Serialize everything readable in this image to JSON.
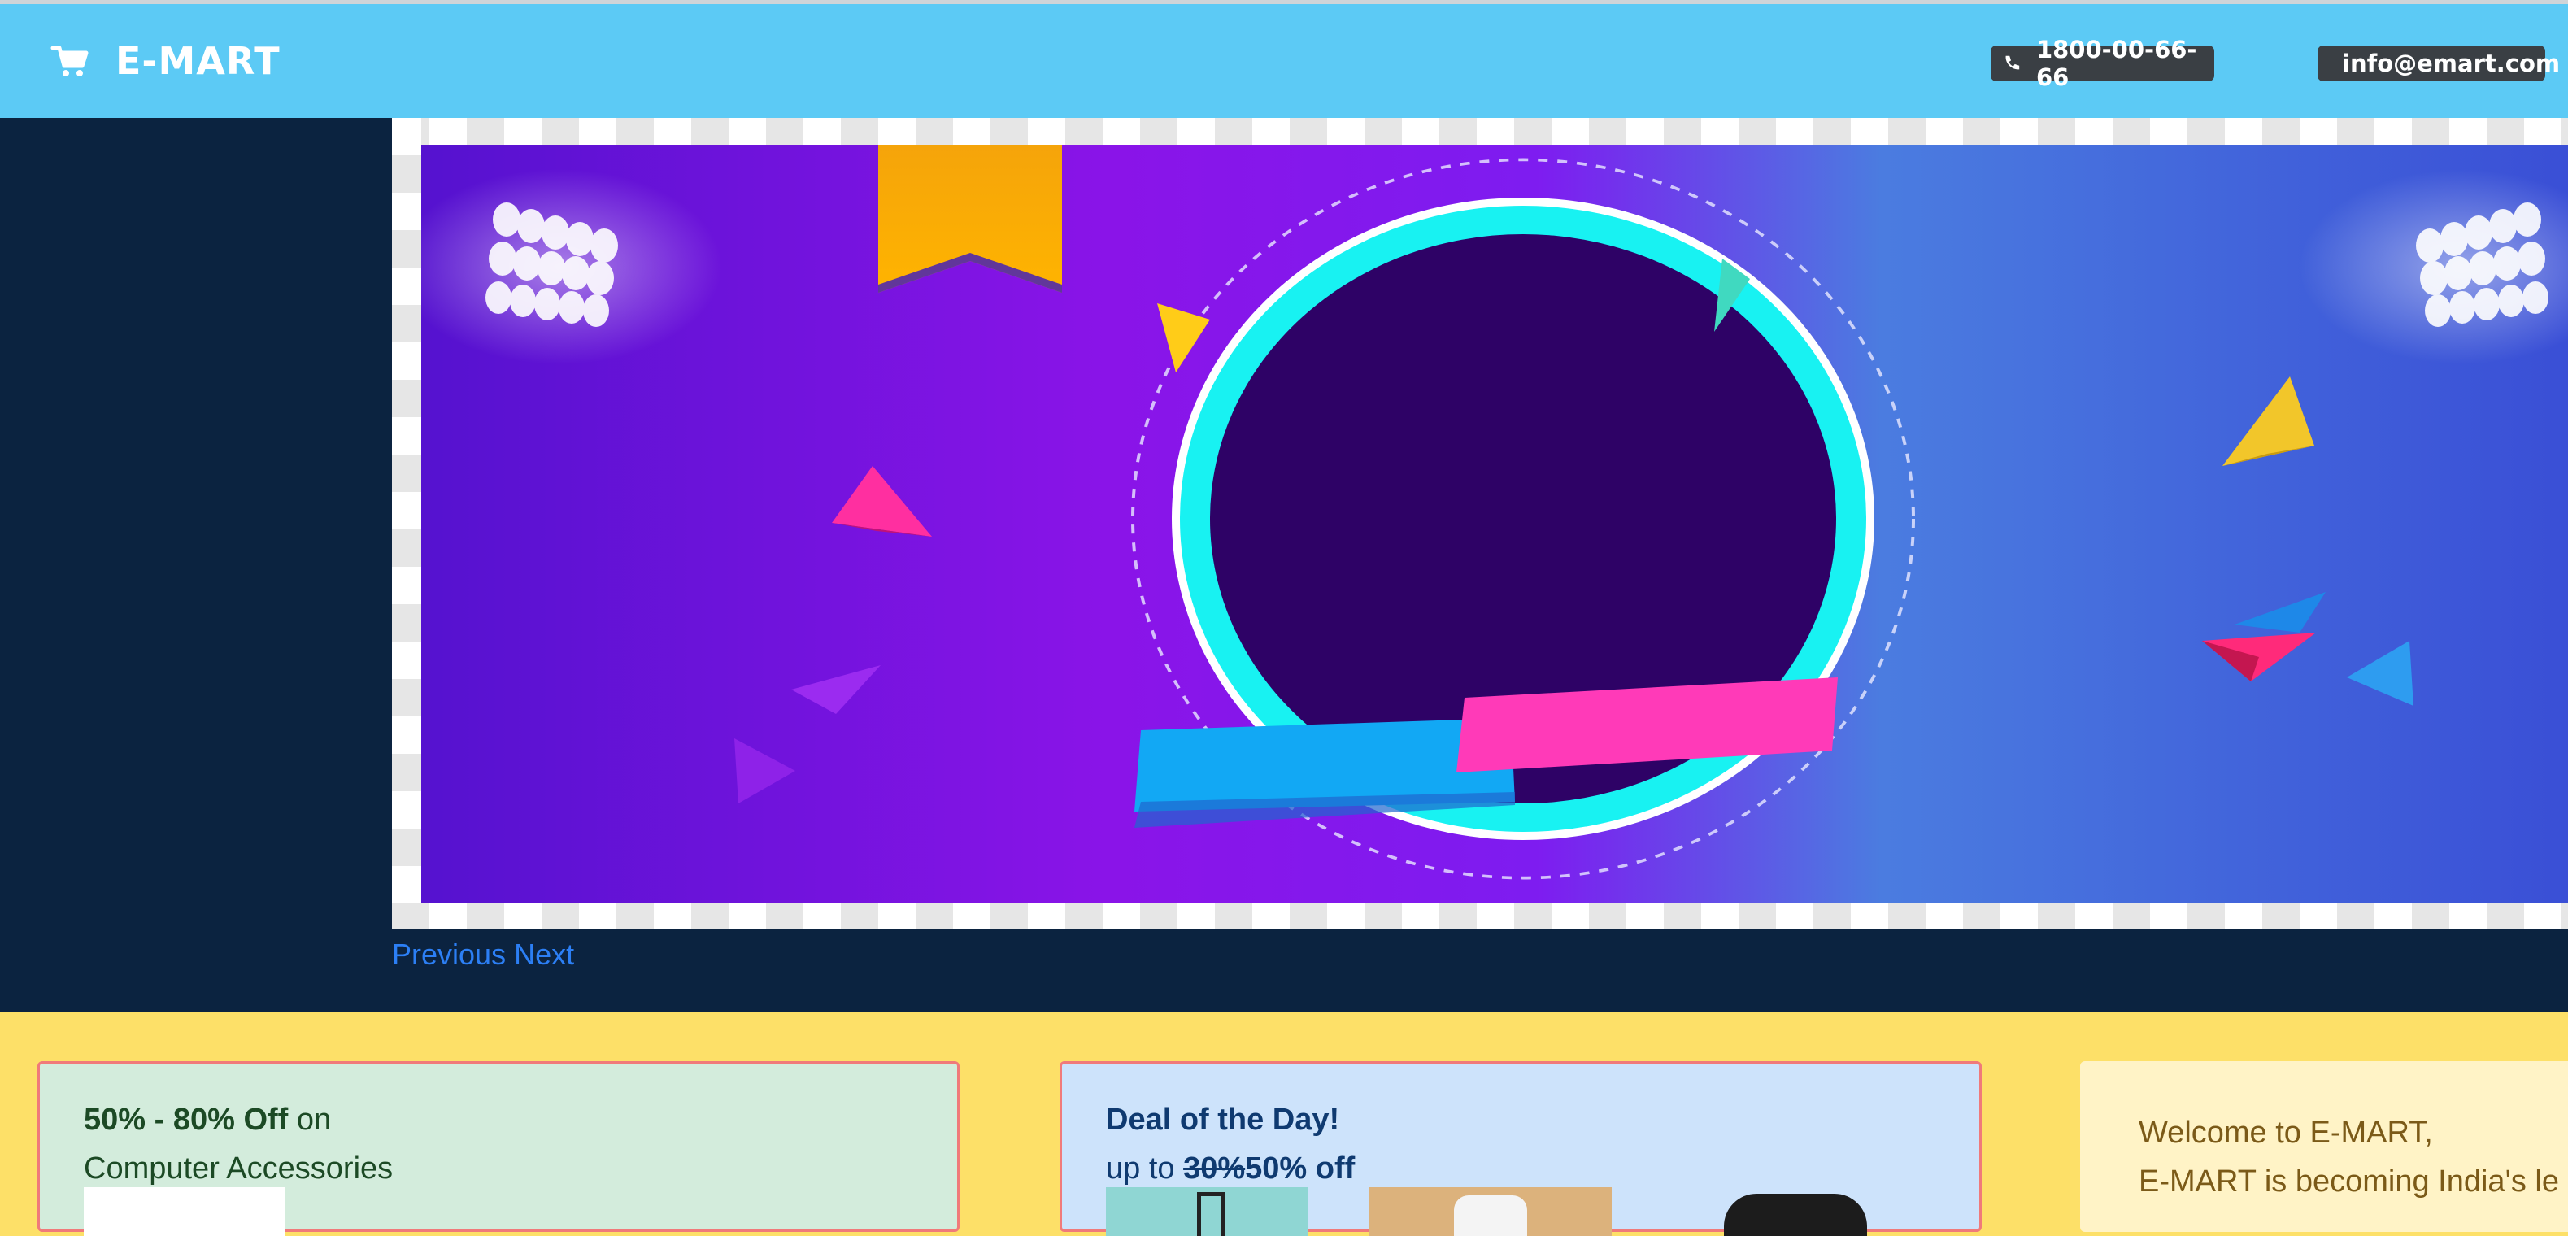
{
  "navbar": {
    "brand": "E-MART",
    "cart_icon": "cart-icon",
    "phone": "1800-00-66-66",
    "phone_icon": "phone-icon",
    "email": "info@emart.com",
    "background": "#5ccaf5"
  },
  "carousel": {
    "previous_label": "Previous",
    "next_label": "Next",
    "background": "#0b2340"
  },
  "cards": {
    "accessories": {
      "discount": "50% - 80% Off",
      "on": "on",
      "category": "Computer Accessories"
    },
    "deal": {
      "title": "Deal of the Day!",
      "prefix": "up to",
      "old_discount": "30%",
      "new_discount": "50% off"
    },
    "welcome": {
      "line1": "Welcome to E-MART,",
      "line2": "E-MART is becoming India's le"
    }
  }
}
